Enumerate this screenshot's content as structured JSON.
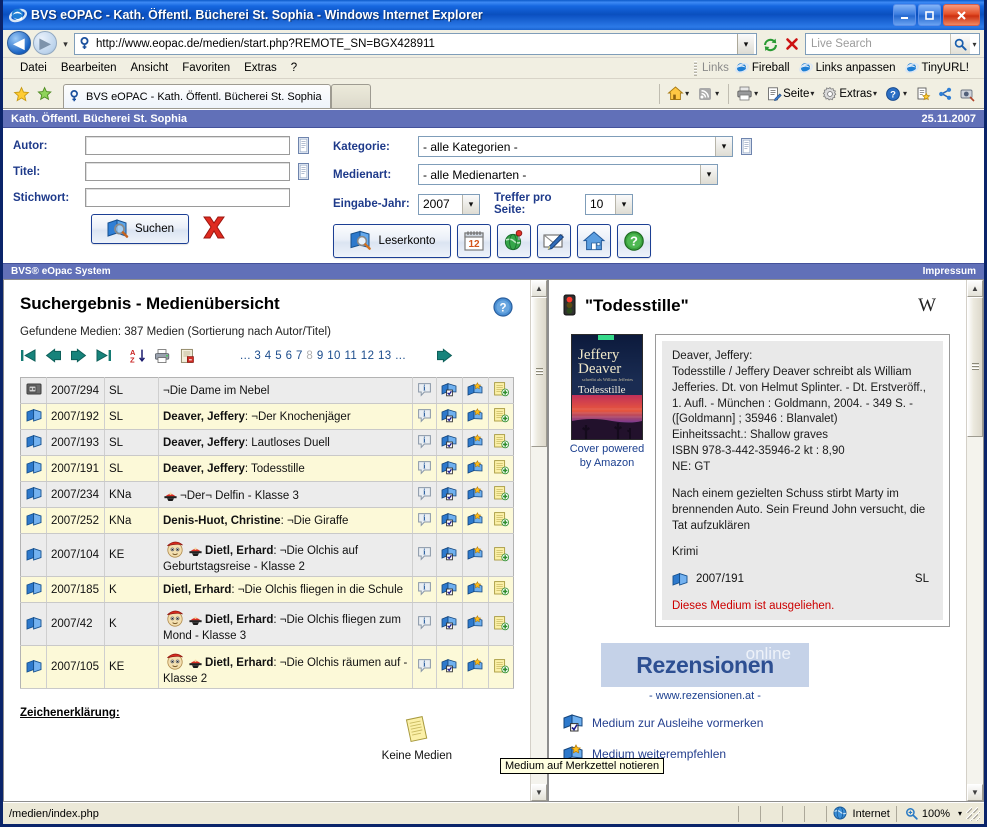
{
  "window": {
    "title": "BVS eOPAC - Kath. Öffentl. Bücherei St. Sophia - Windows Internet Explorer",
    "minimize": "_",
    "maximize": "□",
    "close": "✕"
  },
  "browser": {
    "url": "http://www.eopac.de/medien/start.php?REMOTE_SN=BGX428911",
    "search_placeholder": "Live Search",
    "menu": [
      "Datei",
      "Bearbeiten",
      "Ansicht",
      "Favoriten",
      "Extras",
      "?"
    ],
    "links_label": "Links",
    "links": [
      "Fireball",
      "Links anpassen",
      "TinyURL!"
    ],
    "tab_title": "BVS eOPAC - Kath. Öffentl. Bücherei St. Sophia",
    "toolbar": [
      "Seite",
      "Extras"
    ]
  },
  "app": {
    "header_title": "Kath. Öffentl. Bücherei St. Sophia",
    "header_date": "25.11.2007",
    "footer_left": "BVS® eOpac System",
    "footer_right": "Impressum"
  },
  "search_form": {
    "autor_label": "Autor:",
    "autor_value": "",
    "titel_label": "Titel:",
    "titel_value": "",
    "stichwort_label": "Stichwort:",
    "stichwort_value": "",
    "suchen_label": "Suchen",
    "kategorie_label": "Kategorie:",
    "kategorie_value": "- alle Kategorien -",
    "medienart_label": "Medienart:",
    "medienart_value": "- alle Medienarten -",
    "jahr_label": "Eingabe-Jahr:",
    "jahr_value": "2007",
    "treffer_label": "Treffer pro Seite:",
    "treffer_value": "10",
    "leserkonto_label": "Leserkonto"
  },
  "results": {
    "heading": "Suchergebnis - Medienübersicht",
    "found_text": "Gefundene Medien: 387 Medien (Sortierung nach Autor/Titel)",
    "pagination": {
      "leading_dots": "...",
      "pages": [
        "3",
        "4",
        "5",
        "6",
        "7",
        "8",
        "9",
        "10",
        "11",
        "12",
        "13"
      ],
      "current": "8",
      "trailing_dots": "..."
    },
    "rows": [
      {
        "type_icon": "video-icon",
        "signature": "2007/294",
        "art": "SL",
        "author": "",
        "title": "¬Die Dame im Nebel",
        "has_pirate": false,
        "has_olchi": false
      },
      {
        "type_icon": "book-icon",
        "signature": "2007/192",
        "art": "SL",
        "author": "Deaver, Jeffery",
        "title": "¬Der Knochenjäger",
        "has_pirate": false,
        "has_olchi": false
      },
      {
        "type_icon": "book-icon",
        "signature": "2007/193",
        "art": "SL",
        "author": "Deaver, Jeffery",
        "title": "Lautloses Duell",
        "has_pirate": false,
        "has_olchi": false
      },
      {
        "type_icon": "book-icon",
        "signature": "2007/191",
        "art": "SL",
        "author": "Deaver, Jeffery",
        "title": "Todesstille",
        "has_pirate": false,
        "has_olchi": false
      },
      {
        "type_icon": "book-icon",
        "signature": "2007/234",
        "art": "KNa",
        "author": "",
        "title": "¬Der¬ Delfin - Klasse 3",
        "has_pirate": true,
        "has_olchi": false
      },
      {
        "type_icon": "book-icon",
        "signature": "2007/252",
        "art": "KNa",
        "author": "Denis-Huot, Christine",
        "title": "¬Die Giraffe",
        "has_pirate": false,
        "has_olchi": false
      },
      {
        "type_icon": "book-icon",
        "signature": "2007/104",
        "art": "KE",
        "author": "Dietl, Erhard",
        "title": "¬Die Olchis auf Geburtstagsreise - Klasse 2",
        "has_pirate": true,
        "has_olchi": true
      },
      {
        "type_icon": "book-icon",
        "signature": "2007/185",
        "art": "K",
        "author": "Dietl, Erhard",
        "title": "¬Die Olchis fliegen in die Schule",
        "has_pirate": false,
        "has_olchi": false
      },
      {
        "type_icon": "book-icon",
        "signature": "2007/42",
        "art": "K",
        "author": "Dietl, Erhard",
        "title": "¬Die Olchis fliegen zum Mond - Klasse 3",
        "has_pirate": true,
        "has_olchi": true
      },
      {
        "type_icon": "book-icon",
        "signature": "2007/105",
        "art": "KE",
        "author": "Dietl, Erhard",
        "title": "¬Die Olchis räumen auf - Klasse 2",
        "has_pirate": true,
        "has_olchi": true
      }
    ],
    "legend_label": "Zeichenerklärung:",
    "legend_item": "Keine Medien"
  },
  "detail": {
    "title": "\"Todesstille\"",
    "wiki_logo": "W",
    "cover_caption": "Cover powered by Amazon",
    "cover_author": "Jeffery Deaver",
    "cover_title": "Todesstille",
    "bibliographic": "Deaver, Jeffery:\nTodesstille / Jeffery Deaver schreibt als William Jefferies. Dt. von Helmut Splinter. - Dt. Erstveröff., 1. Aufl. - München : Goldmann, 2004. - 349 S. - ([Goldmann] ; 35946 : Blanvalet)\nEinheitssacht.: Shallow graves\nISBN 978-3-442-35946-2 kt : 8,90\nNE: GT",
    "abstract": "Nach einem gezielten Schuss stirbt Marty im brennenden Auto. Sein Freund John versucht, die Tat aufzuklären",
    "genre": "Krimi",
    "signature": "2007/191",
    "art": "SL",
    "status": "Dieses Medium ist ausgeliehen.",
    "banner_big": "Rezensionen",
    "banner_small": "online",
    "banner_url": "- www.rezensionen.at -",
    "action_reserve": "Medium zur Ausleihe vormerken",
    "action_recommend": "Medium weiterempfehlen"
  },
  "tooltip": "Medium auf Merkzettel notieren",
  "status_bar": {
    "left": "/medien/index.php",
    "zone": "Internet",
    "zoom": "100%"
  },
  "colors": {
    "app_header": "#6170b8",
    "row_odd": "#ececec",
    "row_even": "#fcf9d8",
    "link": "#25408f",
    "status_red": "#cc0000"
  }
}
